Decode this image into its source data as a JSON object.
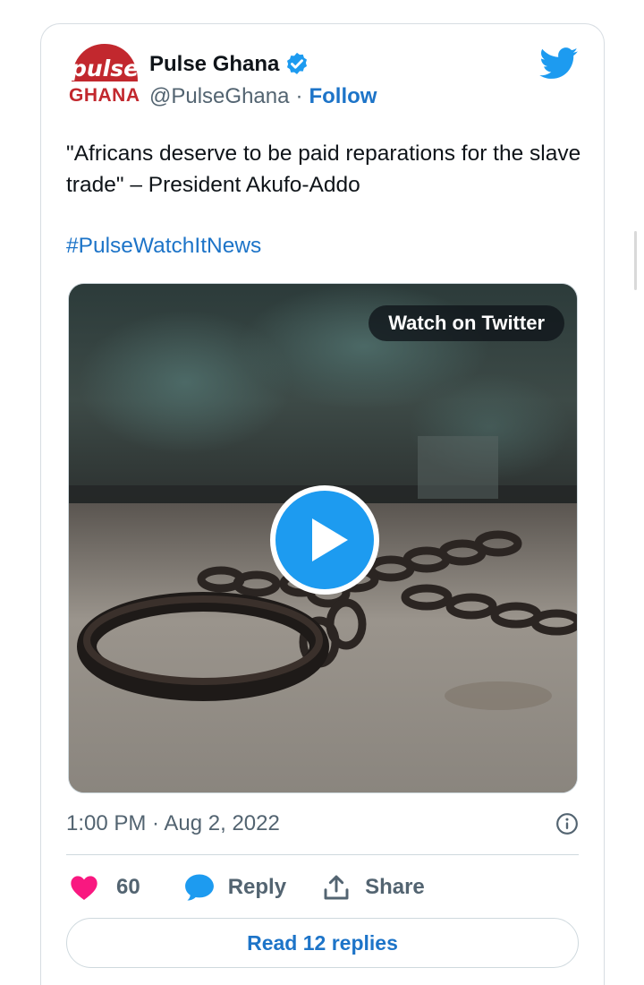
{
  "tweet": {
    "logo_text": "pulse",
    "logo_subtext": "GHANA",
    "display_name": "Pulse Ghana",
    "handle": "@PulseGhana",
    "separator": "·",
    "follow_label": "Follow",
    "text": "\"Africans deserve to be paid reparations for the slave trade\" – President Akufo-Addo",
    "hashtag": "#PulseWatchItNews",
    "media": {
      "watch_label": "Watch on Twitter",
      "play_icon": "play-icon"
    },
    "timestamp": "1:00 PM · Aug 2, 2022",
    "actions": {
      "like_count": "60",
      "reply_label": "Reply",
      "share_label": "Share"
    },
    "read_replies_label": "Read 12 replies"
  },
  "colors": {
    "accent_blue": "#1d74c8",
    "twitter_blue": "#1d9bf0",
    "like_pink": "#f91880",
    "brand_red": "#c2282e",
    "muted_text": "#536471"
  }
}
